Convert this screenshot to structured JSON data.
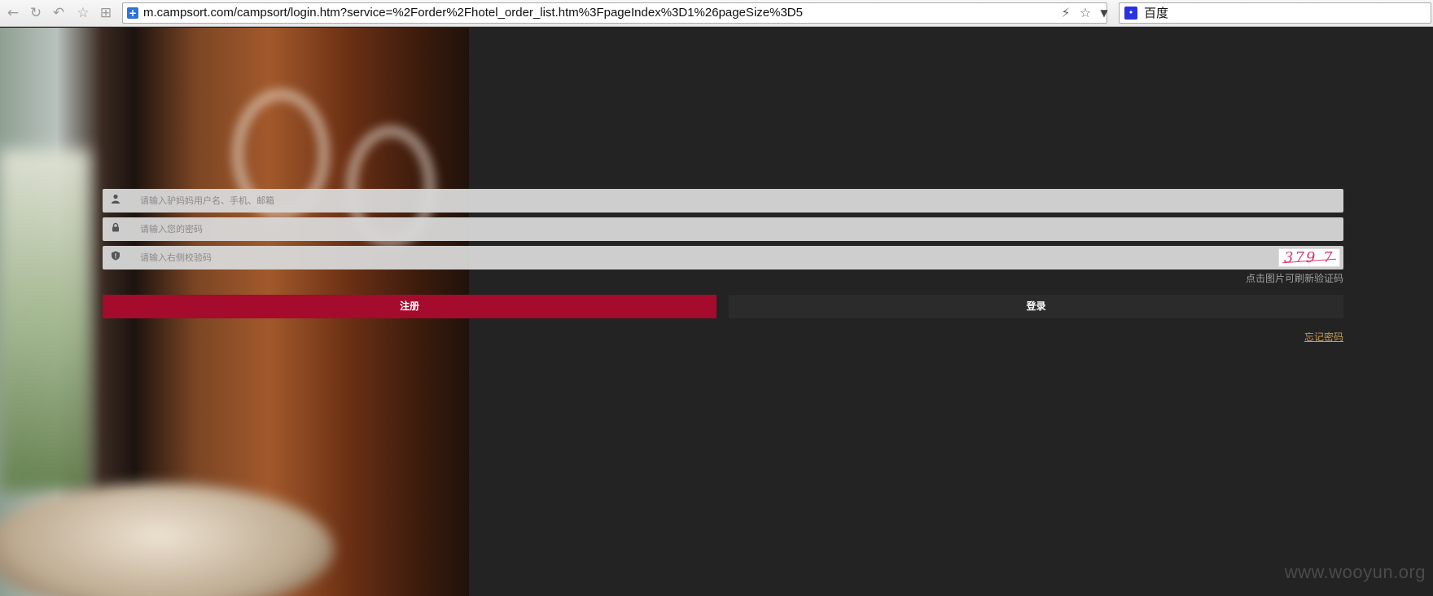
{
  "browser": {
    "url": "m.campsort.com/campsort/login.htm?service=%2Forder%2Fhotel_order_list.htm%3FpageIndex%3D1%26pageSize%3D5",
    "search_engine": "百度",
    "icons": {
      "back": "back-arrow-icon",
      "refresh": "refresh-icon",
      "undo": "undo-icon",
      "favorites": "star-icon",
      "apps": "grid-icon",
      "lightning": "lightning-icon",
      "bookmark": "star-icon",
      "dropdown": "chevron-down-icon"
    }
  },
  "login": {
    "username_placeholder": "请输入驴妈妈用户名、手机、邮箱",
    "password_placeholder": "请输入您的密码",
    "captcha_placeholder": "请输入右侧校验码",
    "captcha_value": "379 7",
    "captcha_hint": "点击图片可刷新验证码",
    "register_label": "注册",
    "login_label": "登录",
    "forgot_password": "忘记密码",
    "icons": {
      "username": "user-icon",
      "password": "lock-icon",
      "captcha": "shield-icon"
    },
    "colors": {
      "register_button": "#a50b2c",
      "login_button": "#2b2b2b",
      "forgot_link": "#c49a5a",
      "page_background": "#232323"
    }
  },
  "watermark": "www.wooyun.org"
}
